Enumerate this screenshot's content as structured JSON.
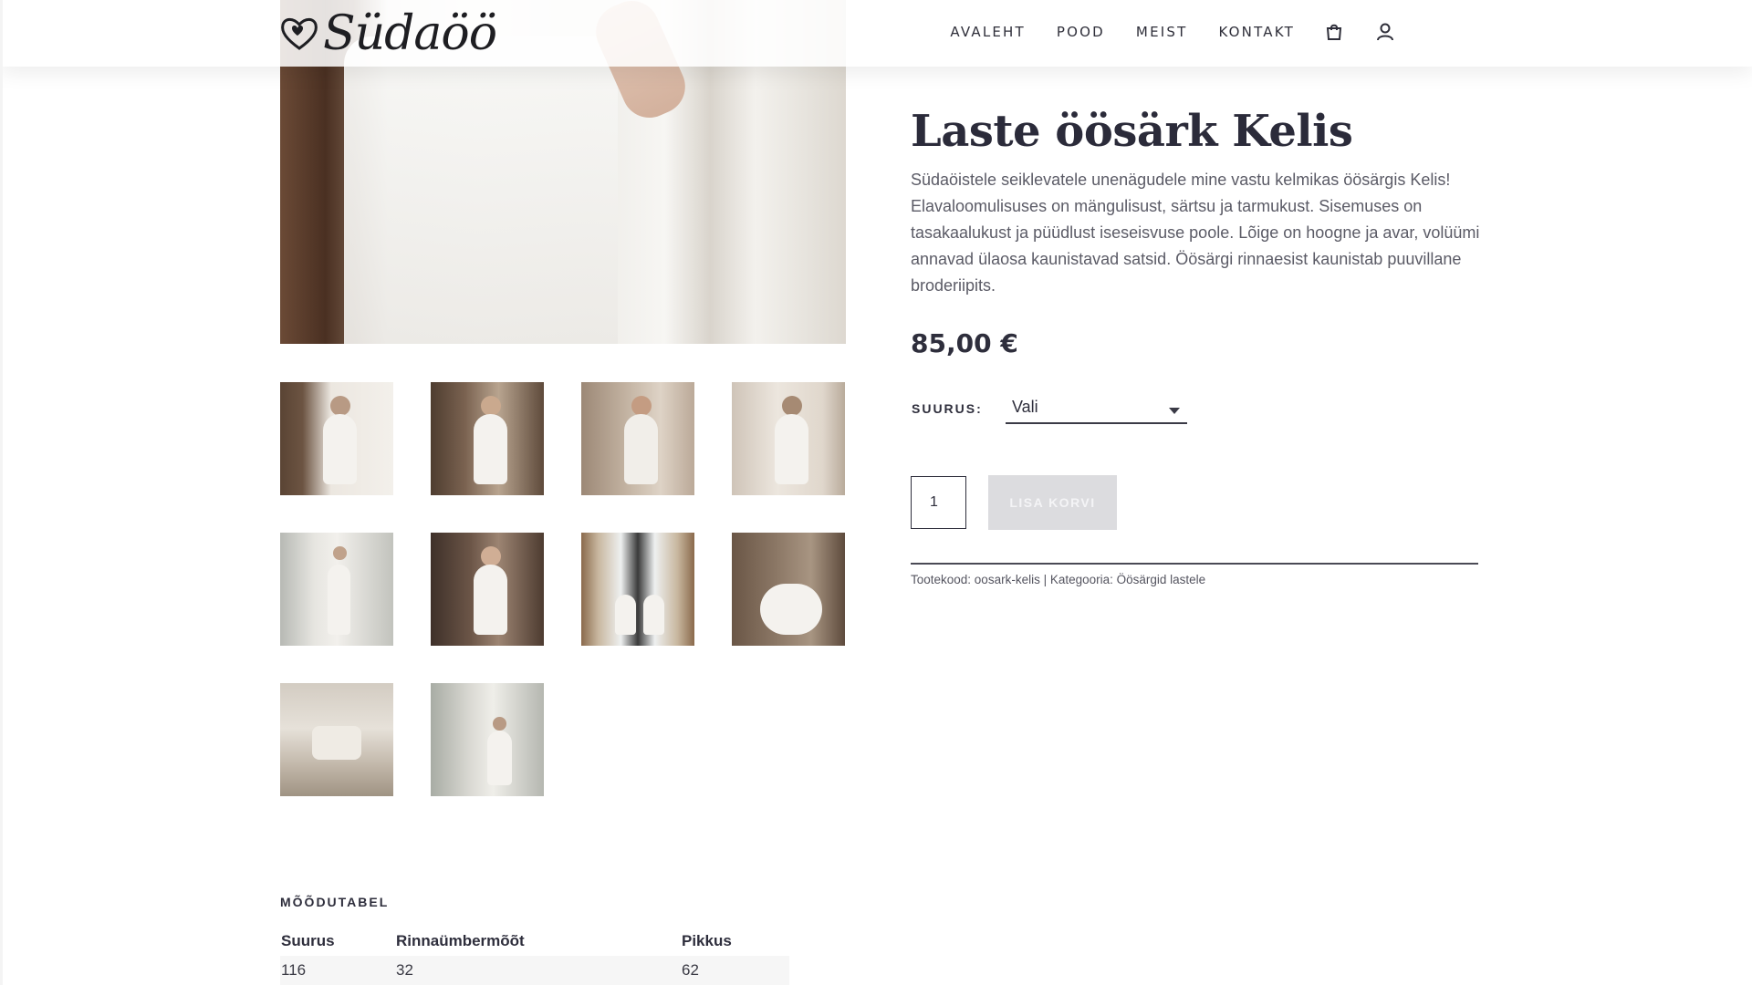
{
  "brand": {
    "name": "Südaöö"
  },
  "nav": {
    "items": [
      "AVALEHT",
      "POOD",
      "MEIST",
      "KONTAKT"
    ],
    "cart_icon": "shopping-bag-icon",
    "account_icon": "user-icon"
  },
  "product": {
    "title": "Laste öösärk Kelis",
    "description": "Südaöistele seiklevatele unenägudele mine vastu kelmikas öösärgis Kelis! Elavaloomulisuses on mängulisust, särtsu ja tarmukust. Sisemuses on tasakaalukust ja püüdlust iseseisvuse poole. Lõige on hoogne ja avar, volüümi annavad ülaosa kaunistavad satsid. Öösärgi rinnaesist kaunistab puuvillane broderiipits.",
    "price": "85,00 €",
    "size_label": "SUURUS:",
    "size_value": "Vali",
    "quantity": "1",
    "add_to_cart": "LISA KORVI",
    "meta": "Tootekood: oosark-kelis | Kategooria: Öösärgid lastele"
  },
  "gallery": {
    "thumbnail_count": 10
  },
  "measurements": {
    "title": "MÕÕDUTABEL",
    "headers": [
      "Suurus",
      "Rinnaümbermõõt",
      "Pikkus"
    ],
    "rows": [
      [
        "116",
        "32",
        "62"
      ]
    ]
  }
}
